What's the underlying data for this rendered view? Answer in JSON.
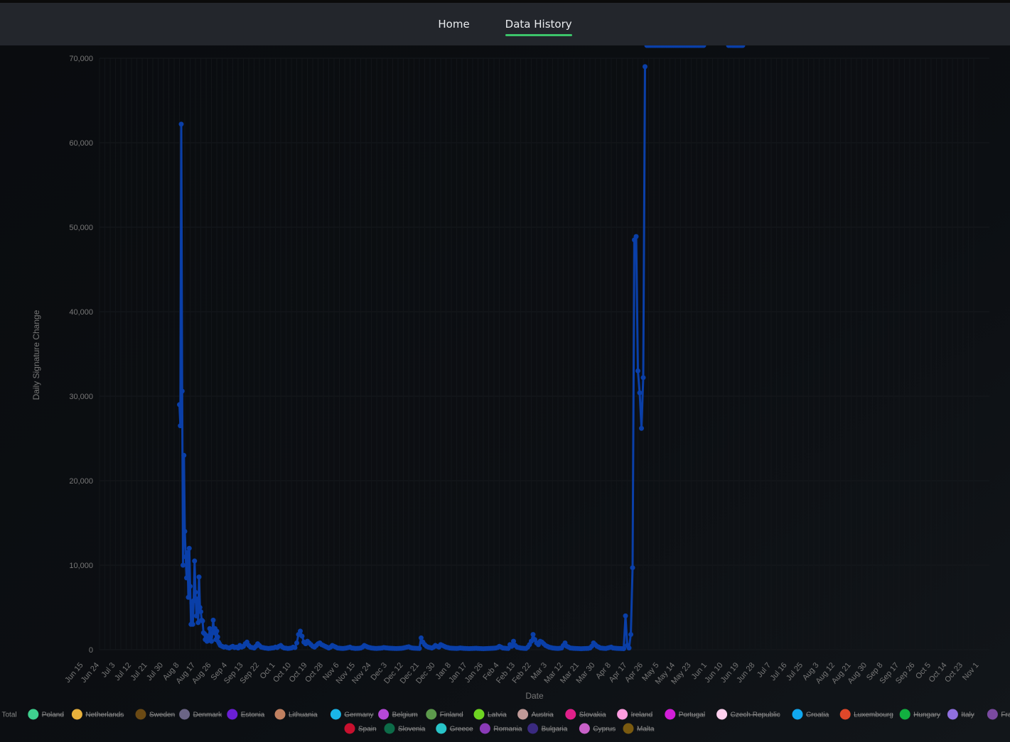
{
  "nav": {
    "items": [
      {
        "label": "Home",
        "active": false
      },
      {
        "label": "Data History",
        "active": true
      }
    ],
    "active_color": "#3cc46a"
  },
  "chart_data": {
    "type": "line",
    "xlabel": "Date",
    "ylabel": "Daily Signature Change",
    "ylim": [
      0,
      70000
    ],
    "y_ticks": [
      "0",
      "10,000",
      "20,000",
      "30,000",
      "40,000",
      "50,000",
      "60,000",
      "70,000"
    ],
    "x_ticks": [
      "Jun 15",
      "Jun 24",
      "Jul 3",
      "Jul 12",
      "Jul 21",
      "Jul 30",
      "Aug 8",
      "Aug 17",
      "Aug 26",
      "Sep 4",
      "Sep 13",
      "Sep 22",
      "Oct 1",
      "Oct 10",
      "Oct 19",
      "Oct 28",
      "Nov 6",
      "Nov 15",
      "Nov 24",
      "Dec 3",
      "Dec 12",
      "Dec 21",
      "Dec 30",
      "Jan 8",
      "Jan 17",
      "Jan 26",
      "Feb 4",
      "Feb 13",
      "Feb 22",
      "Mar 3",
      "Mar 12",
      "Mar 21",
      "Mar 30",
      "Apr 8",
      "Apr 17",
      "Apr 26",
      "May 5",
      "May 14",
      "May 23",
      "Jun 1",
      "Jun 10",
      "Jun 19",
      "Jun 28",
      "Jul 7",
      "Jul 16",
      "Jul 25",
      "Aug 3",
      "Aug 12",
      "Aug 21",
      "Aug 30",
      "Sep 8",
      "Sep 17",
      "Sep 26",
      "Oct 5",
      "Oct 14",
      "Oct 23",
      "Nov 1"
    ],
    "grid": true,
    "legend_position": "bottom",
    "series": [
      {
        "name": "EU Total",
        "color": "#0a3fa8",
        "x_day": [
          57,
          57.5,
          58,
          58.5,
          59,
          59.5,
          60,
          60.5,
          61,
          61.5,
          62,
          62.5,
          63,
          63.5,
          64,
          64.5,
          65,
          65.5,
          66,
          66.5,
          67,
          67.5,
          68,
          68.5,
          69,
          69.5,
          70,
          70.5,
          71,
          71.5,
          72,
          72.5,
          73,
          73.5,
          74,
          74.5,
          75,
          75.5,
          76,
          76.5,
          77,
          77.5,
          78,
          78.5,
          79,
          79.5,
          80,
          81,
          82,
          83,
          84,
          85,
          86,
          87,
          88,
          89,
          90,
          91,
          92,
          93,
          94,
          95,
          96,
          97,
          98,
          99,
          100,
          101,
          102,
          103,
          104,
          105,
          106,
          107,
          108,
          109,
          110,
          111,
          112,
          113,
          114,
          115,
          116,
          117,
          118,
          119,
          120,
          121,
          122,
          123,
          124,
          125,
          126,
          127,
          128,
          129,
          130,
          131,
          132,
          133,
          134,
          135,
          136,
          137,
          138,
          139,
          140,
          141,
          142,
          143,
          144,
          145,
          146,
          147,
          148,
          149,
          150,
          151,
          152,
          153,
          154,
          155,
          156,
          157,
          158,
          159,
          160,
          161,
          162,
          163,
          164,
          165,
          166,
          167,
          168,
          169,
          170,
          171,
          172,
          173,
          174,
          175,
          176,
          177,
          178,
          179,
          180,
          181,
          182,
          183,
          184,
          185,
          186,
          187,
          188,
          189,
          190,
          191,
          192,
          193,
          194,
          195,
          196,
          197,
          198,
          199,
          200,
          201,
          202,
          203,
          204,
          205,
          206,
          207,
          208,
          209,
          210,
          211,
          212,
          213,
          214,
          215,
          216,
          217,
          218,
          219,
          220,
          221,
          222,
          223,
          224,
          225,
          226,
          227,
          228,
          229,
          230,
          231,
          232,
          233,
          234,
          235,
          236,
          237,
          238,
          239,
          240,
          241,
          242,
          243,
          244,
          245,
          246,
          247,
          248,
          249,
          250,
          251,
          252,
          253,
          254,
          255,
          256,
          257,
          258,
          259,
          260,
          261,
          262,
          263,
          264,
          265,
          266,
          267,
          268,
          269,
          270,
          271,
          272,
          273,
          274,
          275,
          276,
          277,
          278,
          279,
          280,
          281,
          282,
          283,
          284,
          285,
          286,
          287,
          288,
          289,
          290,
          291,
          292,
          293,
          294,
          295,
          296,
          297,
          298,
          299,
          300,
          301,
          302,
          303,
          304,
          305,
          306,
          307,
          308,
          309,
          310,
          311,
          312,
          313,
          314,
          315,
          316,
          317,
          318,
          319,
          320,
          321,
          322,
          323,
          324,
          325,
          326,
          327,
          328,
          329,
          330,
          331,
          332,
          333,
          334,
          335,
          336,
          337,
          338,
          339,
          340,
          341,
          342,
          343,
          344,
          345,
          346,
          347,
          348,
          349,
          350,
          351,
          352,
          366,
          367,
          368,
          368.5,
          369,
          369.5,
          370,
          370.5,
          371,
          371.5,
          372,
          372.5,
          373,
          373.5,
          374
        ],
        "values": [
          29000,
          26500,
          62200,
          30600,
          10000,
          23000,
          14000,
          11000,
          8500,
          11500,
          6200,
          12000,
          7500,
          3000,
          5500,
          3000,
          5800,
          10500,
          6800,
          4000,
          6000,
          3200,
          8600,
          5000,
          4500,
          3500,
          3400,
          2000,
          1900,
          1200,
          1700,
          1000,
          1400,
          1100,
          2500,
          1500,
          1000,
          2000,
          3500,
          2000,
          2500,
          1200,
          2200,
          1500,
          900,
          700,
          500,
          400,
          300,
          350,
          250,
          200,
          300,
          400,
          250,
          300,
          200,
          500,
          300,
          400,
          700,
          900,
          500,
          300,
          250,
          200,
          400,
          700,
          500,
          300,
          250,
          200,
          180,
          150,
          170,
          200,
          220,
          300,
          250,
          400,
          500,
          300,
          200,
          180,
          150,
          170,
          200,
          300,
          250,
          800,
          1800,
          2200,
          1600,
          900,
          700,
          1000,
          800,
          600,
          400,
          300,
          500,
          700,
          800,
          600,
          500,
          400,
          300,
          200,
          300,
          500,
          400,
          300,
          200,
          180,
          160,
          150,
          170,
          200,
          250,
          300,
          200,
          180,
          150,
          160,
          170,
          200,
          300,
          500,
          400,
          300,
          250,
          200,
          180,
          160,
          150,
          170,
          180,
          200,
          250,
          220,
          200,
          180,
          170,
          160,
          150,
          140,
          150,
          160,
          170,
          200,
          250,
          300,
          350,
          250,
          200,
          180,
          170,
          160,
          150,
          1400,
          900,
          600,
          400,
          300,
          250,
          200,
          300,
          500,
          400,
          300,
          600,
          500,
          400,
          300,
          250,
          200,
          180,
          170,
          160,
          150,
          170,
          200,
          180,
          160,
          150,
          140,
          130,
          140,
          150,
          160,
          170,
          150,
          140,
          130,
          120,
          130,
          140,
          150,
          160,
          170,
          180,
          200,
          250,
          400,
          300,
          200,
          180,
          160,
          150,
          600,
          400,
          1000,
          500,
          300,
          250,
          200,
          180,
          160,
          150,
          300,
          600,
          1000,
          1800,
          1200,
          800,
          600,
          1000,
          900,
          700,
          500,
          400,
          300,
          250,
          200,
          180,
          160,
          150,
          170,
          200,
          500,
          800,
          400,
          300,
          200,
          180,
          160,
          150,
          140,
          130,
          120,
          130,
          140,
          150,
          160,
          200,
          400,
          800,
          600,
          400,
          300,
          200,
          180,
          160,
          150,
          200,
          250,
          300,
          200,
          180,
          160,
          150,
          140,
          130,
          120,
          4000,
          500,
          200,
          1800,
          9700,
          48500,
          48900,
          33000,
          30400,
          26200,
          32200,
          69000
        ]
      }
    ],
    "legend": [
      {
        "name": "EU Total",
        "color": "#0a3fa8",
        "hidden": false
      },
      {
        "name": "Poland",
        "color": "#3fd08e",
        "hidden": true
      },
      {
        "name": "Netherlands",
        "color": "#e8b13c",
        "hidden": true
      },
      {
        "name": "Sweden",
        "color": "#6b4a14",
        "hidden": true
      },
      {
        "name": "Denmark",
        "color": "#6b6586",
        "hidden": true
      },
      {
        "name": "Estonia",
        "color": "#6a1fd4",
        "hidden": true
      },
      {
        "name": "Lithuania",
        "color": "#c08060",
        "hidden": true
      },
      {
        "name": "Germany",
        "color": "#1ab6e8",
        "hidden": true
      },
      {
        "name": "Belgium",
        "color": "#b548d8",
        "hidden": true
      },
      {
        "name": "Finland",
        "color": "#5c9a4c",
        "hidden": true
      },
      {
        "name": "Latvia",
        "color": "#6ed422",
        "hidden": true
      },
      {
        "name": "Austria",
        "color": "#c09a98",
        "hidden": true
      },
      {
        "name": "Slovakia",
        "color": "#e0208a",
        "hidden": true
      },
      {
        "name": "Ireland",
        "color": "#ff9ce0",
        "hidden": true
      },
      {
        "name": "Portugal",
        "color": "#d21ed8",
        "hidden": true
      },
      {
        "name": "Czech Republic",
        "color": "#ffd0ee",
        "hidden": true
      },
      {
        "name": "Croatia",
        "color": "#10a8f0",
        "hidden": true
      },
      {
        "name": "Luxembourg",
        "color": "#e0482a",
        "hidden": true
      },
      {
        "name": "Hungary",
        "color": "#12b040",
        "hidden": true
      },
      {
        "name": "Italy",
        "color": "#9070e0",
        "hidden": true
      },
      {
        "name": "France",
        "color": "#7a4aa0",
        "hidden": true
      },
      {
        "name": "Spain",
        "color": "#c8102e",
        "hidden": true
      },
      {
        "name": "Slovenia",
        "color": "#0d6b48",
        "hidden": true
      },
      {
        "name": "Greece",
        "color": "#28c4c8",
        "hidden": true
      },
      {
        "name": "Romania",
        "color": "#8a3ab8",
        "hidden": true
      },
      {
        "name": "Bulgaria",
        "color": "#3a2a80",
        "hidden": true
      },
      {
        "name": "Cyprus",
        "color": "#c860c8",
        "hidden": true
      },
      {
        "name": "Malta",
        "color": "#7a5a10",
        "hidden": true
      }
    ]
  }
}
